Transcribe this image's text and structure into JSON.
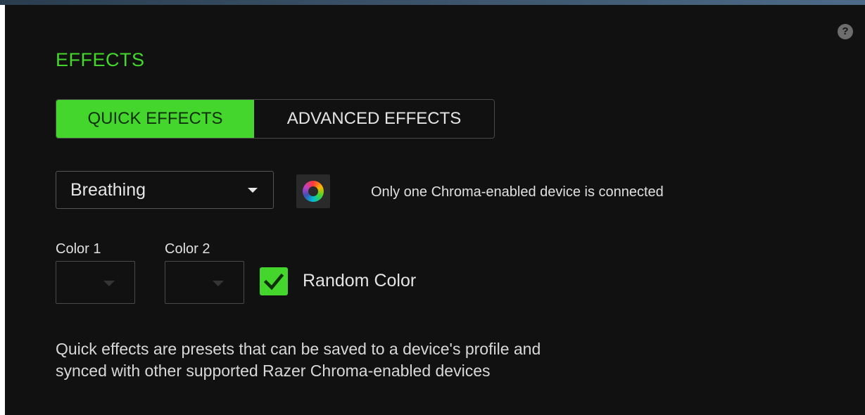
{
  "help_icon": {
    "glyph": "?"
  },
  "effects": {
    "title": "EFFECTS",
    "tabs": [
      {
        "label": "QUICK EFFECTS",
        "active": true
      },
      {
        "label": "ADVANCED EFFECTS",
        "active": false
      }
    ],
    "effect_dropdown": {
      "value": "Breathing"
    },
    "chroma_status": "Only one Chroma-enabled device is connected",
    "color1_label": "Color 1",
    "color2_label": "Color 2",
    "random_color": {
      "label": "Random Color",
      "checked": true
    },
    "description_line1": "Quick effects are presets that can be saved to a device's profile and",
    "description_line2": "synced with other supported Razer Chroma-enabled devices"
  },
  "colors": {
    "accent": "#44d62c",
    "background": "#111111",
    "text": "#d8d8d8"
  }
}
